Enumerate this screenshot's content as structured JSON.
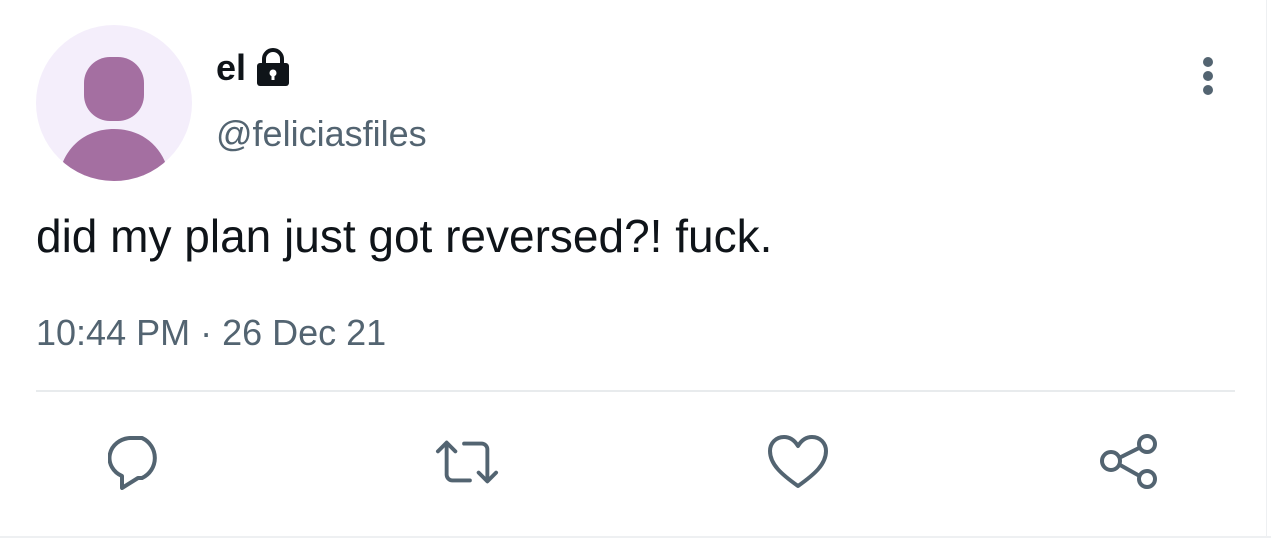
{
  "author": {
    "display_name": "el",
    "handle": "@feliciasfiles",
    "protected_icon": "lock-icon",
    "avatar_icon": "default-avatar-icon"
  },
  "tweet": {
    "text": "did my plan just got reversed?! fuck.",
    "time": "10:44 PM",
    "separator": "·",
    "date": "26 Dec 21"
  },
  "actions": {
    "more_icon": "more-vertical-icon",
    "reply_icon": "reply-icon",
    "retweet_icon": "retweet-icon",
    "like_icon": "heart-icon",
    "share_icon": "share-icon"
  },
  "colors": {
    "text_primary": "#0f1419",
    "text_secondary": "#536471",
    "avatar_bg": "#f4eefb",
    "avatar_fg": "#a46fa1",
    "divider": "#e8ebed"
  }
}
